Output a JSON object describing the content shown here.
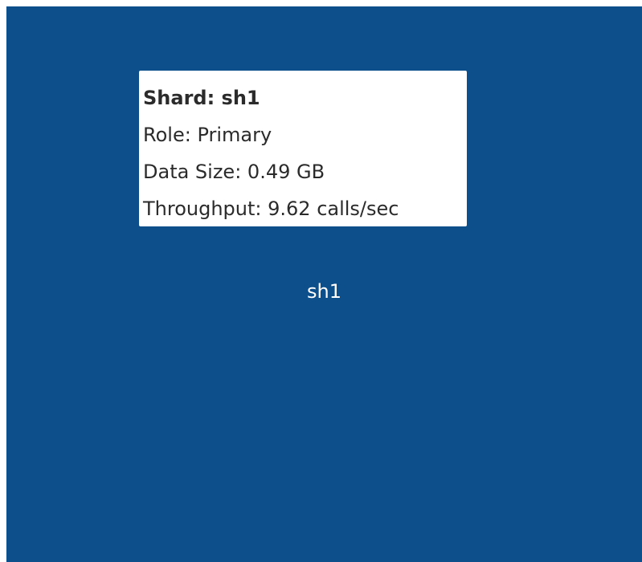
{
  "treemap": {
    "tile_label": "sh1",
    "tile_color": "#0d4f8b"
  },
  "tooltip": {
    "title_prefix": "Shard: ",
    "title_value": "sh1",
    "role_label": "Role: ",
    "role_value": "Primary",
    "size_label": "Data Size: ",
    "size_value": "0.49 GB",
    "throughput_label": "Throughput: ",
    "throughput_value": "9.62 calls/sec"
  }
}
